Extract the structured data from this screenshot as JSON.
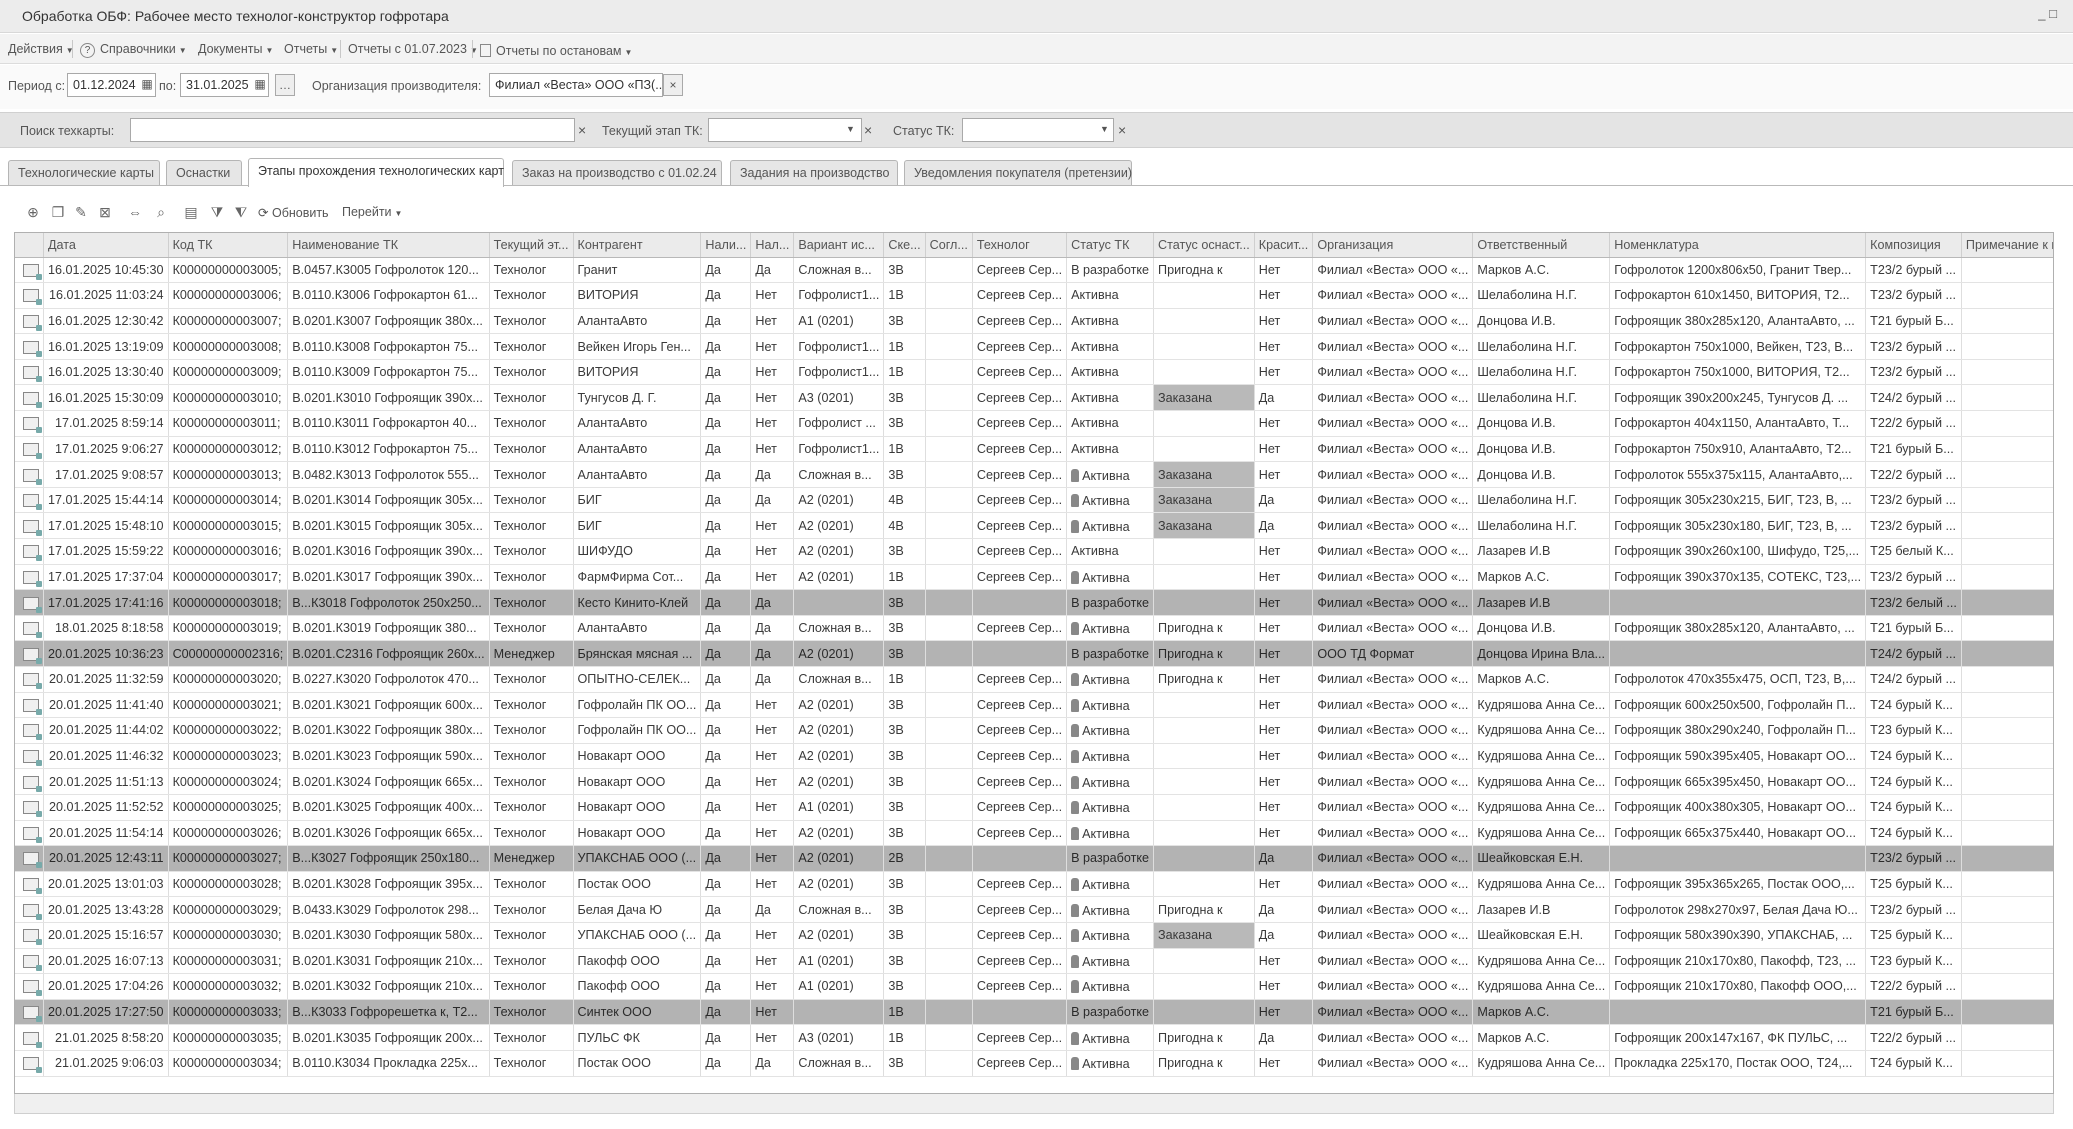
{
  "window": {
    "title": "Обработка  ОБФ: Рабочее место технолог-конструктор гофротара",
    "controls": "_ □"
  },
  "menu": [
    {
      "label": "Действия",
      "icon": ""
    },
    {
      "label": "Справочники",
      "icon": "help-icon"
    },
    {
      "label": "Документы",
      "icon": ""
    },
    {
      "label": "Отчеты",
      "icon": ""
    },
    {
      "label": "Отчеты с 01.07.2023",
      "icon": ""
    },
    {
      "label": "Отчеты по остановам",
      "icon": "report-icon"
    }
  ],
  "filters": {
    "period_label": "Период с:",
    "date_from": "01.12.2024",
    "to_label": "по:",
    "date_to": "31.01.2025",
    "org_label": "Организация производителя:",
    "org_value": "Филиал «Веста» ООО «ПЗ(...",
    "search_label": "Поиск техкарты:",
    "search_value": "",
    "stage_label": "Текущий этап ТК:",
    "stage_value": "",
    "status_label": "Статус ТК:",
    "status_value": ""
  },
  "tabs": [
    "Технологические карты",
    "Оснастки",
    "Этапы прохождения технологических карт",
    "Заказ на производство с 01.02.24",
    "Задания на производство",
    "Уведомления покупателя (претензии)"
  ],
  "active_tab": 2,
  "toolbar": {
    "refresh_label": "Обновить",
    "goto_label": "Перейти"
  },
  "columns": [
    "",
    "Дата",
    "Код ТК",
    "Наименование ТК",
    "Текущий эт...",
    "Контрагент",
    "Нали...",
    "Нал...",
    "Вариант ис...",
    "Ске...",
    "Согл...",
    "Технолог",
    "Статус ТК",
    "Статус оснаст...",
    "Красит...",
    "Организация",
    "Ответственный",
    "Номенклатура",
    "Композиция",
    "Примечание к произ...",
    "Пр"
  ],
  "rows": [
    [
      "16.01.2025 10:45:30",
      "К00000000003005;",
      "В.0457.К3005 Гофролоток 120...",
      "Технолог",
      "Гранит",
      "Да",
      "Да",
      "Сложная в...",
      "3В",
      "",
      "Сергеев Сер...",
      "В разработке",
      "Пригодна к",
      "Нет",
      "Филиал «Веста» ООО «...",
      "Марков А.С.",
      "Гофролоток 1200х806х50, Гранит Твер...",
      "Т23/2 бурый ...",
      "",
      ":"
    ],
    [
      "16.01.2025 11:03:24",
      "К00000000003006;",
      "В.0110.К3006 Гофрокартон 61...",
      "Технолог",
      "ВИТОРИЯ",
      "Да",
      "Нет",
      "Гофролист1...",
      "1В",
      "",
      "Сергеев Сер...",
      "Активна",
      "",
      "Нет",
      "Филиал «Веста» ООО «...",
      "Шелаболина Н.Г.",
      "Гофрокартон 610х1450, ВИТОРИЯ, Т2...",
      "Т23/2 бурый ...",
      "",
      ":"
    ],
    [
      "16.01.2025 12:30:42",
      "К00000000003007;",
      "В.0201.К3007 Гофроящик 380х...",
      "Технолог",
      "АлантаАвто",
      "Да",
      "Нет",
      "А1 (0201)",
      "3В",
      "",
      "Сергеев Сер...",
      "Активна",
      "",
      "Нет",
      "Филиал «Веста» ООО «...",
      "Донцова И.В.",
      "Гофроящик 380х285х120, АлантаАвто, ...",
      "Т21 бурый Б...",
      "",
      ":"
    ],
    [
      "16.01.2025 13:19:09",
      "К00000000003008;",
      "В.0110.К3008 Гофрокартон 75...",
      "Технолог",
      "Вейкен Игорь Ген...",
      "Да",
      "Нет",
      "Гофролист1...",
      "1В",
      "",
      "Сергеев Сер...",
      "Активна",
      "",
      "Нет",
      "Филиал «Веста» ООО «...",
      "Шелаболина Н.Г.",
      "Гофрокартон 750х1000, Вейкен, Т23, В...",
      "Т23/2 бурый ...",
      "",
      ":"
    ],
    [
      "16.01.2025 13:30:40",
      "К00000000003009;",
      "В.0110.К3009 Гофрокартон 75...",
      "Технолог",
      "ВИТОРИЯ",
      "Да",
      "Нет",
      "Гофролист1...",
      "1В",
      "",
      "Сергеев Сер...",
      "Активна",
      "",
      "Нет",
      "Филиал «Веста» ООО «...",
      "Шелаболина Н.Г.",
      "Гофрокартон 750х1000, ВИТОРИЯ, Т2...",
      "Т23/2 бурый ...",
      "",
      ":"
    ],
    [
      "16.01.2025 15:30:09",
      "К00000000003010;",
      "В.0201.К3010 Гофроящик 390х...",
      "Технолог",
      "Тунгусов Д. Г.",
      "Да",
      "Нет",
      "А3 (0201)",
      "3В",
      "",
      "Сергеев Сер...",
      "Активна",
      "Заказана",
      "Да",
      "Филиал «Веста» ООО «...",
      "Шелаболина Н.Г.",
      "Гофроящик 390х200х245, Тунгусов Д. ...",
      "Т24/2 бурый ...",
      "",
      ":"
    ],
    [
      "17.01.2025 8:59:14",
      "К00000000003011;",
      "В.0110.К3011 Гофрокартон 40...",
      "Технолог",
      "АлантаАвто",
      "Да",
      "Нет",
      "Гофролист ...",
      "3В",
      "",
      "Сергеев Сер...",
      "Активна",
      "",
      "Нет",
      "Филиал «Веста» ООО «...",
      "Донцова И.В.",
      "Гофрокартон 404х1150, АлантаАвто, Т...",
      "Т22/2 бурый ...",
      "",
      ":"
    ],
    [
      "17.01.2025 9:06:27",
      "К00000000003012;",
      "В.0110.К3012 Гофрокартон 75...",
      "Технолог",
      "АлантаАвто",
      "Да",
      "Нет",
      "Гофролист1...",
      "1В",
      "",
      "Сергеев Сер...",
      "Активна",
      "",
      "Нет",
      "Филиал «Веста» ООО «...",
      "Донцова И.В.",
      "Гофрокартон 750х910, АлантаАвто, Т2...",
      "Т21 бурый Б...",
      "",
      ":"
    ],
    [
      "17.01.2025 9:08:57",
      "К00000000003013;",
      "В.0482.К3013 Гофролоток 555...",
      "Технолог",
      "АлантаАвто",
      "Да",
      "Да",
      "Сложная в...",
      "3В",
      "",
      "Сергеев Сер...",
      "Активна",
      "Заказана",
      "Нет",
      "Филиал «Веста» ООО «...",
      "Донцова И.В.",
      "Гофролоток 555х375х115, АлантаАвто,...",
      "Т22/2 бурый ...",
      "",
      ":"
    ],
    [
      "17.01.2025 15:44:14",
      "К00000000003014;",
      "В.0201.К3014 Гофроящик 305х...",
      "Технолог",
      "БИГ",
      "Да",
      "Да",
      "А2 (0201)",
      "4В",
      "",
      "Сергеев Сер...",
      "Активна",
      "Заказана",
      "Да",
      "Филиал «Веста» ООО «...",
      "Шелаболина Н.Г.",
      "Гофроящик 305х230х215, БИГ, Т23, В, ...",
      "Т23/2 бурый ...",
      "",
      ":"
    ],
    [
      "17.01.2025 15:48:10",
      "К00000000003015;",
      "В.0201.К3015 Гофроящик 305х...",
      "Технолог",
      "БИГ",
      "Да",
      "Нет",
      "А2 (0201)",
      "4В",
      "",
      "Сергеев Сер...",
      "Активна",
      "Заказана",
      "Да",
      "Филиал «Веста» ООО «...",
      "Шелаболина Н.Г.",
      "Гофроящик 305х230х180, БИГ, Т23, В, ...",
      "Т23/2 бурый ...",
      "",
      ":"
    ],
    [
      "17.01.2025 15:59:22",
      "К00000000003016;",
      "В.0201.К3016 Гофроящик 390х...",
      "Технолог",
      "ШИФУДО",
      "Да",
      "Нет",
      "А2 (0201)",
      "3В",
      "",
      "Сергеев Сер...",
      "Активна",
      "",
      "Нет",
      "Филиал «Веста» ООО «...",
      "Лазарев И.В",
      "Гофроящик 390х260х100, Шифудо, Т25,...",
      "Т25 белый К...",
      "",
      ":"
    ],
    [
      "17.01.2025 17:37:04",
      "К00000000003017;",
      "В.0201.К3017 Гофроящик 390х...",
      "Технолог",
      "ФармФирма Сот...",
      "Да",
      "Нет",
      "А2 (0201)",
      "1В",
      "",
      "Сергеев Сер...",
      "Активна",
      "",
      "Нет",
      "Филиал «Веста» ООО «...",
      "Марков А.С.",
      "Гофроящик 390х370х135, СОТЕКС, Т23,...",
      "Т23/2 бурый ...",
      "",
      ":"
    ],
    [
      "17.01.2025 17:41:16",
      "К00000000003018;",
      "В...К3018 Гофролоток 250х250...",
      "Технолог",
      "Кесто Кинито-Клей",
      "Да",
      "Да",
      "",
      "3В",
      "",
      "",
      "В разработке",
      "",
      "Нет",
      "Филиал «Веста» ООО «...",
      "Лазарев И.В",
      "",
      "Т23/2 белый ...",
      "",
      ":"
    ],
    [
      "18.01.2025 8:18:58",
      "К00000000003019;",
      "В.0201.К3019 Гофроящик 380...",
      "Технолог",
      "АлантаАвто",
      "Да",
      "Да",
      "Сложная в...",
      "3В",
      "",
      "Сергеев Сер...",
      "Активна",
      "Пригодна к",
      "Нет",
      "Филиал «Веста» ООО «...",
      "Донцова И.В.",
      "Гофроящик 380х285х120, АлантаАвто, ...",
      "Т21 бурый Б...",
      "",
      ":"
    ],
    [
      "20.01.2025 10:36:23",
      "С00000000002316;",
      "В.0201.С2316 Гофроящик 260х...",
      "Менеджер",
      "Брянская мясная ...",
      "Да",
      "Да",
      "А2 (0201)",
      "3В",
      "",
      "",
      "В разработке",
      "Пригодна к",
      "Нет",
      "ООО ТД Формат",
      "Донцова Ирина Вла...",
      "",
      "Т24/2 бурый ...",
      "",
      ":"
    ],
    [
      "20.01.2025 11:32:59",
      "К00000000003020;",
      "В.0227.К3020 Гофролоток 470...",
      "Технолог",
      "ОПЫТНО-СЕЛЕК...",
      "Да",
      "Да",
      "Сложная в...",
      "1В",
      "",
      "Сергеев Сер...",
      "Активна",
      "Пригодна к",
      "Нет",
      "Филиал «Веста» ООО «...",
      "Марков А.С.",
      "Гофролоток 470х355х475, ОСП, Т23, В,...",
      "Т24/2 бурый ...",
      "",
      ":"
    ],
    [
      "20.01.2025 11:41:40",
      "К00000000003021;",
      "В.0201.К3021 Гофроящик 600х...",
      "Технолог",
      "Гофролайн ПК ОО...",
      "Да",
      "Нет",
      "А2 (0201)",
      "3В",
      "",
      "Сергеев Сер...",
      "Активна",
      "",
      "Нет",
      "Филиал «Веста» ООО «...",
      "Кудряшова Анна Се...",
      "Гофроящик 600х250х500, Гофролайн П...",
      "Т24 бурый К...",
      "",
      ":"
    ],
    [
      "20.01.2025 11:44:02",
      "К00000000003022;",
      "В.0201.К3022 Гофроящик 380х...",
      "Технолог",
      "Гофролайн ПК ОО...",
      "Да",
      "Нет",
      "А2 (0201)",
      "3В",
      "",
      "Сергеев Сер...",
      "Активна",
      "",
      "Нет",
      "Филиал «Веста» ООО «...",
      "Кудряшова Анна Се...",
      "Гофроящик 380х290х240, Гофролайн П...",
      "Т23 бурый К...",
      "",
      ":"
    ],
    [
      "20.01.2025 11:46:32",
      "К00000000003023;",
      "В.0201.К3023 Гофроящик 590х...",
      "Технолог",
      "Новакарт ООО",
      "Да",
      "Нет",
      "А2 (0201)",
      "3В",
      "",
      "Сергеев Сер...",
      "Активна",
      "",
      "Нет",
      "Филиал «Веста» ООО «...",
      "Кудряшова Анна Се...",
      "Гофроящик 590х395х405, Новакарт ОО...",
      "Т24 бурый К...",
      "",
      ":"
    ],
    [
      "20.01.2025 11:51:13",
      "К00000000003024;",
      "В.0201.К3024 Гофроящик 665х...",
      "Технолог",
      "Новакарт ООО",
      "Да",
      "Нет",
      "А2 (0201)",
      "3В",
      "",
      "Сергеев Сер...",
      "Активна",
      "",
      "Нет",
      "Филиал «Веста» ООО «...",
      "Кудряшова Анна Се...",
      "Гофроящик 665х395х450, Новакарт ОО...",
      "Т24 бурый К...",
      "",
      ":"
    ],
    [
      "20.01.2025 11:52:52",
      "К00000000003025;",
      "В.0201.К3025 Гофроящик 400х...",
      "Технолог",
      "Новакарт ООО",
      "Да",
      "Нет",
      "А1 (0201)",
      "3В",
      "",
      "Сергеев Сер...",
      "Активна",
      "",
      "Нет",
      "Филиал «Веста» ООО «...",
      "Кудряшова Анна Се...",
      "Гофроящик 400х380х305, Новакарт ОО...",
      "Т24 бурый К...",
      "",
      ":"
    ],
    [
      "20.01.2025 11:54:14",
      "К00000000003026;",
      "В.0201.К3026 Гофроящик 665х...",
      "Технолог",
      "Новакарт ООО",
      "Да",
      "Нет",
      "А2 (0201)",
      "3В",
      "",
      "Сергеев Сер...",
      "Активна",
      "",
      "Нет",
      "Филиал «Веста» ООО «...",
      "Кудряшова Анна Се...",
      "Гофроящик 665х375х440, Новакарт ОО...",
      "Т24 бурый К...",
      "",
      ":"
    ],
    [
      "20.01.2025 12:43:11",
      "К00000000003027;",
      "В...К3027 Гофроящик 250х180...",
      "Менеджер",
      "УПАКСНАБ ООО (...",
      "Да",
      "Нет",
      "А2 (0201)",
      "2В",
      "",
      "",
      "В разработке",
      "",
      "Да",
      "Филиал «Веста» ООО «...",
      "Шеайковская Е.Н.",
      "",
      "Т23/2 бурый ...",
      "",
      ":"
    ],
    [
      "20.01.2025 13:01:03",
      "К00000000003028;",
      "В.0201.К3028 Гофроящик 395х...",
      "Технолог",
      "Постак ООО",
      "Да",
      "Нет",
      "А2 (0201)",
      "3В",
      "",
      "Сергеев Сер...",
      "Активна",
      "",
      "Нет",
      "Филиал «Веста» ООО «...",
      "Кудряшова Анна Се...",
      "Гофроящик 395х365х265, Постак ООО,...",
      "Т25 бурый К...",
      "",
      ":"
    ],
    [
      "20.01.2025 13:43:28",
      "К00000000003029;",
      "В.0433.К3029 Гофролоток 298...",
      "Технолог",
      "Белая Дача Ю",
      "Да",
      "Да",
      "Сложная в...",
      "3В",
      "",
      "Сергеев Сер...",
      "Активна",
      "Пригодна к",
      "Да",
      "Филиал «Веста» ООО «...",
      "Лазарев И.В",
      "Гофролоток 298х270х97, Белая Дача Ю...",
      "Т23/2 бурый ...",
      "",
      ":"
    ],
    [
      "20.01.2025 15:16:57",
      "К00000000003030;",
      "В.0201.К3030 Гофроящик 580х...",
      "Технолог",
      "УПАКСНАБ ООО (...",
      "Да",
      "Нет",
      "А2 (0201)",
      "3В",
      "",
      "Сергеев Сер...",
      "Активна",
      "Заказана",
      "Да",
      "Филиал «Веста» ООО «...",
      "Шеайковская Е.Н.",
      "Гофроящик 580х390х390, УПАКСНАБ, ...",
      "Т25 бурый К...",
      "",
      ":"
    ],
    [
      "20.01.2025 16:07:13",
      "К00000000003031;",
      "В.0201.К3031 Гофроящик 210х...",
      "Технолог",
      "Пакофф ООО",
      "Да",
      "Нет",
      "А1 (0201)",
      "3В",
      "",
      "Сергеев Сер...",
      "Активна",
      "",
      "Нет",
      "Филиал «Веста» ООО «...",
      "Кудряшова Анна Се...",
      "Гофроящик 210х170х80, Пакофф, Т23, ...",
      "Т23 бурый К...",
      "",
      ":"
    ],
    [
      "20.01.2025 17:04:26",
      "К00000000003032;",
      "В.0201.К3032 Гофроящик 210х...",
      "Технолог",
      "Пакофф ООО",
      "Да",
      "Нет",
      "А1 (0201)",
      "3В",
      "",
      "Сергеев Сер...",
      "Активна",
      "",
      "Нет",
      "Филиал «Веста» ООО «...",
      "Кудряшова Анна Се...",
      "Гофроящик 210х170х80, Пакофф ООО,...",
      "Т22/2 бурый ...",
      "",
      ":"
    ],
    [
      "20.01.2025 17:27:50",
      "К00000000003033;",
      "В...К3033 Гофрорешетка к, Т2...",
      "Технолог",
      "Синтек ООО",
      "Да",
      "Нет",
      "",
      "1В",
      "",
      "",
      "В разработке",
      "",
      "Нет",
      "Филиал «Веста» ООО «...",
      "Марков А.С.",
      "",
      "Т21 бурый Б...",
      "",
      ":"
    ],
    [
      "21.01.2025 8:58:20",
      "К00000000003035;",
      "В.0201.К3035 Гофроящик 200х...",
      "Технолог",
      "ПУЛЬС ФК",
      "Да",
      "Нет",
      "А3 (0201)",
      "1В",
      "",
      "Сергеев Сер...",
      "Активна",
      "Пригодна к",
      "Да",
      "Филиал «Веста» ООО «...",
      "Марков А.С.",
      "Гофроящик 200х147х167, ФК ПУЛЬС, ...",
      "Т22/2 бурый ...",
      "",
      ":"
    ],
    [
      "21.01.2025 9:06:03",
      "К00000000003034;",
      "В.0110.К3034 Прокладка 225х...",
      "Технолог",
      "Постак ООО",
      "Да",
      "Да",
      "Сложная в...",
      "3В",
      "",
      "Сергеев Сер...",
      "Активна",
      "Пригодна к",
      "Нет",
      "Филиал «Веста» ООО «...",
      "Кудряшова Анна Се...",
      "Прокладка 225х170, Постак ООО, Т24,...",
      "Т24 бурый К...",
      "",
      ":"
    ]
  ],
  "highlighted_rows": [
    13,
    15,
    23,
    29
  ],
  "icon_status_rows": [
    8,
    9,
    10,
    12,
    14,
    16,
    17,
    18,
    19,
    20,
    21,
    22,
    24,
    25,
    26,
    27,
    28,
    30,
    31
  ]
}
